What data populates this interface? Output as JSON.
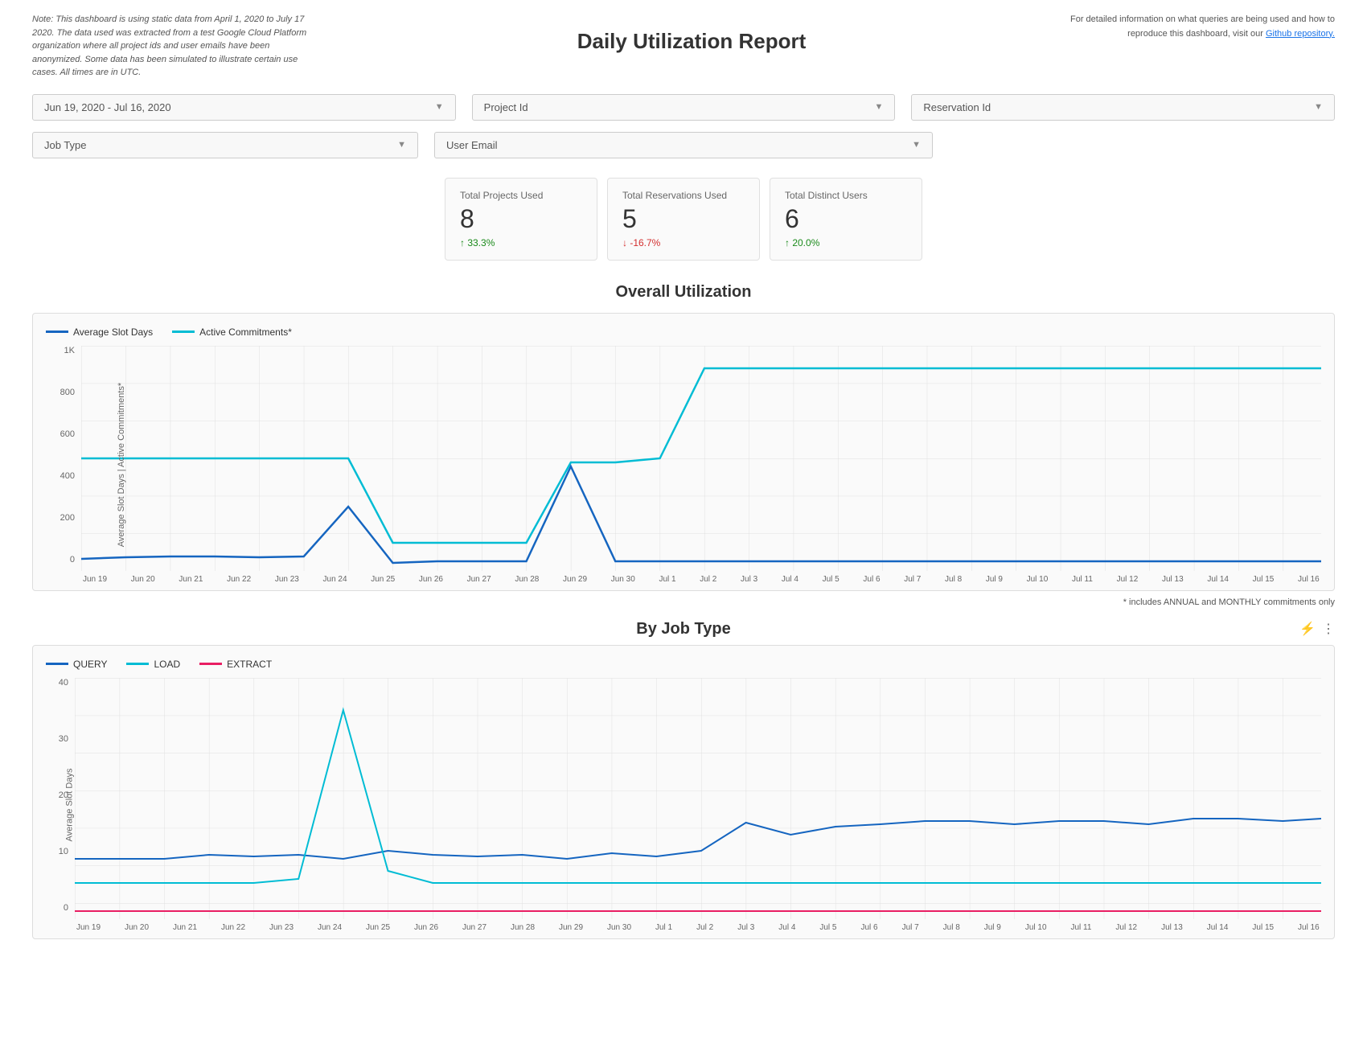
{
  "header": {
    "note": "Note: This dashboard is using static data from April 1, 2020 to July 17 2020. The data used was extracted from a test Google Cloud Platform organization where all project ids and user emails have been anonymized. Some data has been simulated to illustrate certain use cases. All times are in UTC.",
    "title": "Daily Utilization Report",
    "right_text": "For detailed information on what queries are being used and how to reproduce this dashboard, visit our",
    "link_text": "Github repository.",
    "link_url": "#"
  },
  "filters": {
    "date_range": "Jun 19, 2020 - Jul 16, 2020",
    "project_id": "Project Id",
    "reservation_id": "Reservation Id",
    "job_type": "Job Type",
    "user_email": "User Email"
  },
  "stats": [
    {
      "label": "Total Projects Used",
      "value": "8",
      "change": "↑ 33.3%",
      "direction": "up"
    },
    {
      "label": "Total Reservations Used",
      "value": "5",
      "change": "↓ -16.7%",
      "direction": "down"
    },
    {
      "label": "Total Distinct Users",
      "value": "6",
      "change": "↑ 20.0%",
      "direction": "up"
    }
  ],
  "overall_utilization": {
    "title": "Overall Utilization",
    "legend": [
      {
        "label": "Average Slot Days",
        "color": "#1565c0"
      },
      {
        "label": "Active Commitments*",
        "color": "#00bcd4"
      }
    ],
    "y_axis_label": "Average Slot Days | Active Commitments*",
    "note": "* includes ANNUAL and MONTHLY commitments only",
    "x_labels": [
      "Jun 19",
      "Jun 20",
      "Jun 21",
      "Jun 22",
      "Jun 23",
      "Jun 24",
      "Jun 25",
      "Jun 26",
      "Jun 27",
      "Jun 28",
      "Jun 29",
      "Jun 30",
      "Jul 1",
      "Jul 2",
      "Jul 3",
      "Jul 4",
      "Jul 5",
      "Jul 6",
      "Jul 7",
      "Jul 8",
      "Jul 9",
      "Jul 10",
      "Jul 11",
      "Jul 12",
      "Jul 13",
      "Jul 14",
      "Jul 15",
      "Jul 16"
    ],
    "y_labels": [
      "0",
      "200",
      "400",
      "600",
      "800",
      "1K"
    ]
  },
  "by_job_type": {
    "title": "By Job Type",
    "legend": [
      {
        "label": "QUERY",
        "color": "#1565c0"
      },
      {
        "label": "LOAD",
        "color": "#00bcd4"
      },
      {
        "label": "EXTRACT",
        "color": "#e91e63"
      }
    ],
    "y_axis_label": "Average Slot Days",
    "y_labels": [
      "0",
      "10",
      "20",
      "30",
      "40"
    ]
  }
}
